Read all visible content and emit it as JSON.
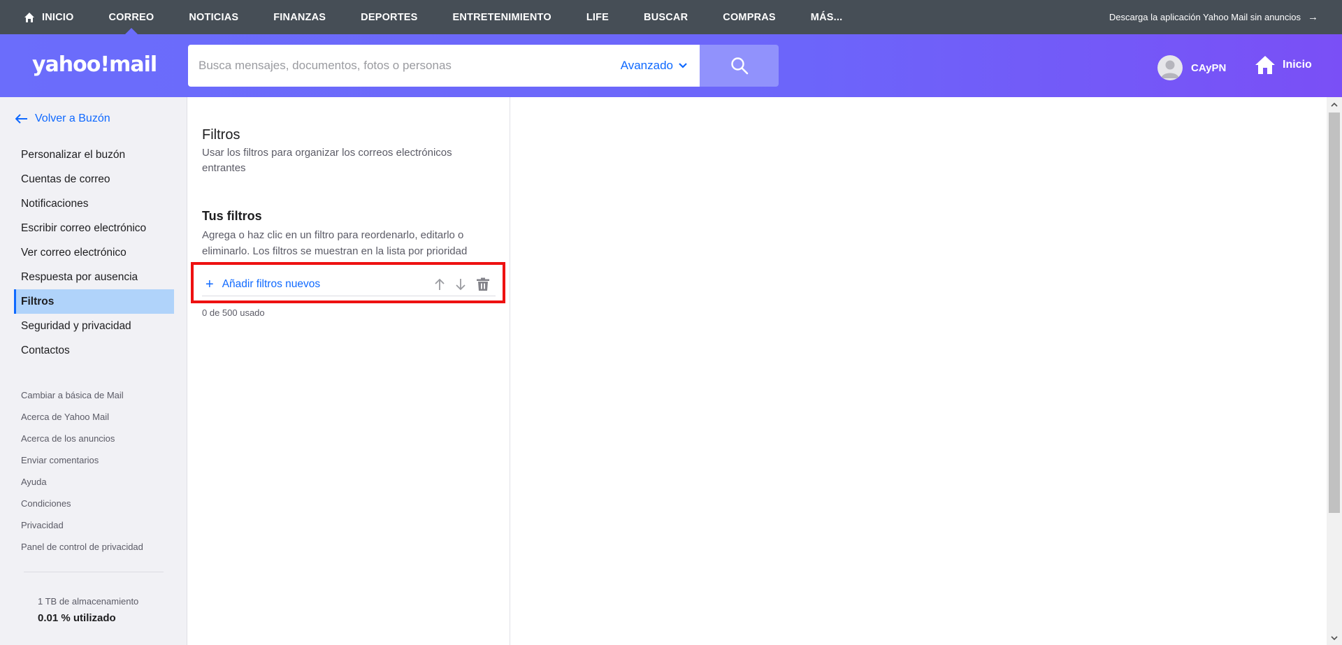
{
  "topnav": {
    "items": [
      {
        "label": "INICIO"
      },
      {
        "label": "CORREO"
      },
      {
        "label": "NOTICIAS"
      },
      {
        "label": "FINANZAS"
      },
      {
        "label": "DEPORTES"
      },
      {
        "label": "ENTRETENIMIENTO"
      },
      {
        "label": "LIFE"
      },
      {
        "label": "BUSCAR"
      },
      {
        "label": "COMPRAS"
      },
      {
        "label": "MÁS..."
      }
    ],
    "active": "CORREO",
    "promo": "Descarga la aplicación Yahoo Mail sin anuncios"
  },
  "header": {
    "logo": "yahoo!mail",
    "search_placeholder": "Busca mensajes, documentos, fotos o personas",
    "advanced_label": "Avanzado",
    "user_name": "CAyPN",
    "home_label": "Inicio"
  },
  "sidebar": {
    "back_label": "Volver a Buzón",
    "items": [
      {
        "label": "Personalizar el buzón"
      },
      {
        "label": "Cuentas de correo"
      },
      {
        "label": "Notificaciones"
      },
      {
        "label": "Escribir correo electrónico"
      },
      {
        "label": "Ver correo electrónico"
      },
      {
        "label": "Respuesta por ausencia"
      },
      {
        "label": "Filtros"
      },
      {
        "label": "Seguridad y privacidad"
      },
      {
        "label": "Contactos"
      }
    ],
    "active": "Filtros",
    "links": [
      {
        "label": "Cambiar a básica de Mail"
      },
      {
        "label": "Acerca de Yahoo Mail"
      },
      {
        "label": "Acerca de los anuncios"
      },
      {
        "label": "Enviar comentarios"
      },
      {
        "label": "Ayuda"
      },
      {
        "label": "Condiciones"
      },
      {
        "label": "Privacidad"
      },
      {
        "label": "Panel de control de privacidad"
      }
    ],
    "storage_label": "1 TB de almacenamiento",
    "storage_used": "0.01 % utilizado"
  },
  "filters": {
    "title": "Filtros",
    "description": "Usar los filtros para organizar los correos electrónicos entrantes",
    "your_filters_title": "Tus filtros",
    "your_filters_description": "Agrega o haz clic en un filtro para reordenarlo, editarlo o eliminarlo. Los filtros se muestran en la lista por prioridad",
    "add_label": "Añadir filtros nuevos",
    "count_label": "0 de 500 usado"
  },
  "colors": {
    "topnav_bg": "#464e56",
    "header_accent": "#6b6dfb",
    "link_blue": "#0f69ff",
    "active_item_bg": "#b0d3fa",
    "highlight_red": "#ee1111"
  },
  "icons": {
    "home": "home-icon",
    "search": "search-icon",
    "avatar": "avatar-icon",
    "back": "arrow-left-icon",
    "move_up": "arrow-up-icon",
    "move_down": "arrow-down-icon",
    "delete": "trash-icon"
  }
}
